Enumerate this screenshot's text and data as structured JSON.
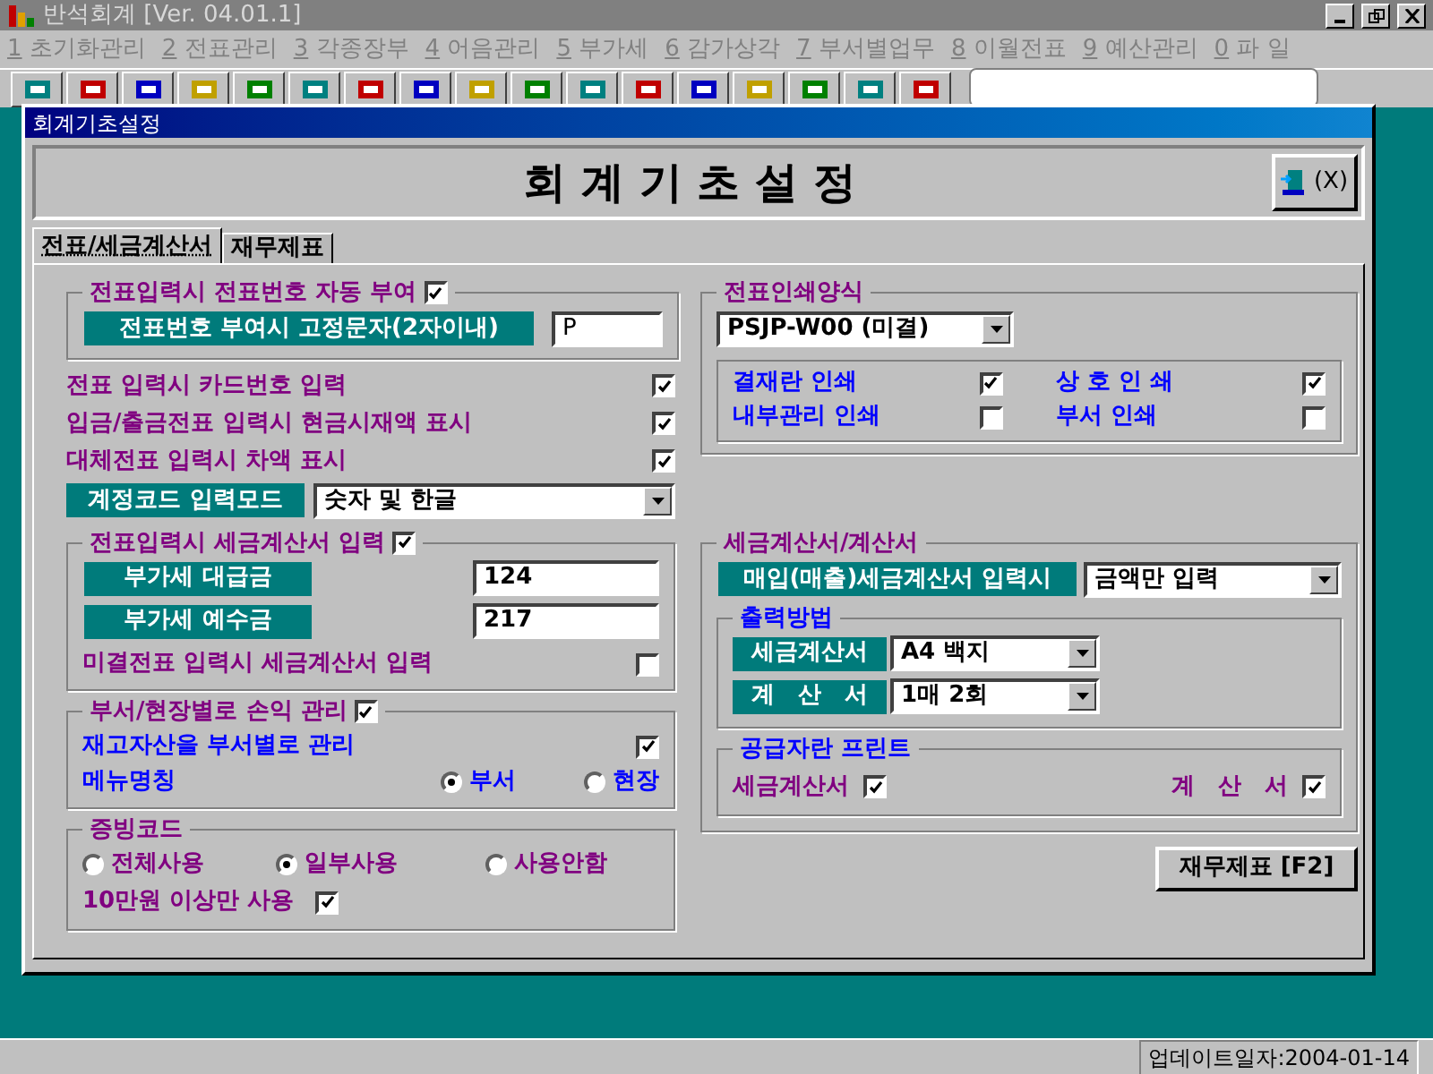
{
  "app": {
    "title": "반석회계 [Ver. 04.01.1]"
  },
  "menu": [
    {
      "key": "1",
      "label": "초기화관리"
    },
    {
      "key": "2",
      "label": "전표관리"
    },
    {
      "key": "3",
      "label": "각종장부"
    },
    {
      "key": "4",
      "label": "어음관리"
    },
    {
      "key": "5",
      "label": "부가세"
    },
    {
      "key": "6",
      "label": "감가상각"
    },
    {
      "key": "7",
      "label": "부서별업무"
    },
    {
      "key": "8",
      "label": "이월전표"
    },
    {
      "key": "9",
      "label": "예산관리"
    },
    {
      "key": "0",
      "label": "파 일"
    }
  ],
  "dialog": {
    "title": "회계기초설정",
    "heading": "회 계 기 초 설 정",
    "close_button": "(X)",
    "tabs": [
      {
        "label": "전표/세금계산서",
        "selected": true
      },
      {
        "label": "재무제표",
        "selected": false
      }
    ],
    "voucher_number": {
      "title": "전표입력시 전표번호 자동 부여",
      "checked": true,
      "fixed_char_label": "전표번호 부여시 고정문자(2자이내)",
      "fixed_char_value": "P"
    },
    "options": [
      {
        "label": "전표 입력시 카드번호 입력",
        "checked": true
      },
      {
        "label": "입금/출금전표 입력시 현금시재액 표시",
        "checked": true
      },
      {
        "label": "대체전표 입력시 차액 표시",
        "checked": true
      }
    ],
    "account_code_mode": {
      "label": "계정코드 입력모드",
      "value": "숫자 및 한글"
    },
    "tax_invoice_input": {
      "title": "전표입력시 세금계산서 입력",
      "checked": true,
      "fields": [
        {
          "label": "부가세 대급금",
          "value": "124"
        },
        {
          "label": "부가세 예수금",
          "value": "217"
        }
      ],
      "unsettled": {
        "label": "미결전표 입력시 세금계산서 입력",
        "checked": false
      }
    },
    "department": {
      "title": "부서/현장별로 손익 관리",
      "checked": true,
      "inventory": {
        "label": "재고자산을 부서별로 관리",
        "checked": true
      },
      "menu_name": {
        "label": "메뉴명칭",
        "options": [
          {
            "label": "부서",
            "selected": true
          },
          {
            "label": "현장",
            "selected": false
          }
        ]
      }
    },
    "evidence_code": {
      "title": "증빙코드",
      "options": [
        {
          "label": "전체사용",
          "selected": false
        },
        {
          "label": "일부사용",
          "selected": true
        },
        {
          "label": "사용안함",
          "selected": false
        }
      ],
      "over_100k": {
        "label": "10만원 이상만 사용",
        "checked": true
      }
    },
    "print_format": {
      "title": "전표인쇄양식",
      "value": "PSJP-W00 (미결)",
      "options": [
        {
          "label": "결재란 인쇄",
          "checked": true
        },
        {
          "label": "상 호 인 쇄",
          "checked": true
        },
        {
          "label": "내부관리 인쇄",
          "checked": false
        },
        {
          "label": "부서 인쇄",
          "checked": false
        }
      ]
    },
    "tax_invoice": {
      "title": "세금계산서/계산서",
      "input_mode": {
        "label": "매입(매출)세금계산서 입력시",
        "value": "금액만 입력"
      },
      "output_method": {
        "title": "출력방법",
        "rows": [
          {
            "label": "세금계산서",
            "value": "A4 백지"
          },
          {
            "label": "계　산　서",
            "value": "1매 2회"
          }
        ]
      },
      "supplier_print": {
        "title": "공급자란 프린트",
        "items": [
          {
            "label": "세금계산서",
            "checked": true
          },
          {
            "label": "계　산　서",
            "checked": true
          }
        ]
      }
    },
    "financial_button": "재무제표 [F2]"
  },
  "status_bar": {
    "update": "업데이트일자:2004-01-14"
  }
}
